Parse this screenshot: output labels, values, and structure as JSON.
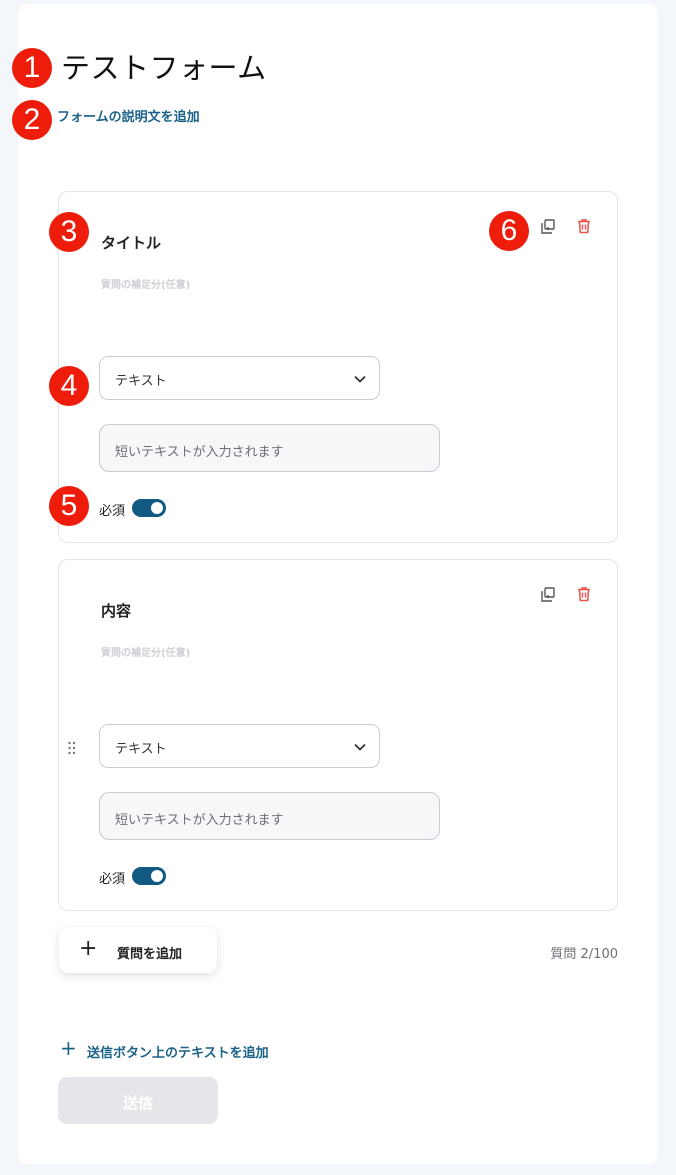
{
  "form": {
    "title": "テストフォーム",
    "description_link": "フォームの説明文を追加"
  },
  "annotations": [
    "1",
    "2",
    "3",
    "4",
    "5",
    "6"
  ],
  "questions": [
    {
      "title": "タイトル",
      "subtitle": "質問の補足分(任意)",
      "type": "テキスト",
      "placeholder": "短いテキストが入力されます",
      "required_label": "必須",
      "required": true
    },
    {
      "title": "内容",
      "subtitle": "質問の補足分(任意)",
      "type": "テキスト",
      "placeholder": "短いテキストが入力されます",
      "required_label": "必須",
      "required": true
    }
  ],
  "footer": {
    "add_question": "質問を追加",
    "question_count": "質問 2/100",
    "add_submit_text": "送信ボタン上のテキストを追加",
    "submit_label": "送信"
  },
  "colors": {
    "accent": "#1b6288",
    "toggle": "#125a82",
    "trash": "#e5554a",
    "badge": "#ee1c0a"
  },
  "icons": {
    "copy": "copy-icon",
    "trash": "trash-icon",
    "chevron": "chevron-down-icon",
    "drag": "drag-handle-icon",
    "plus": "plus-icon"
  }
}
